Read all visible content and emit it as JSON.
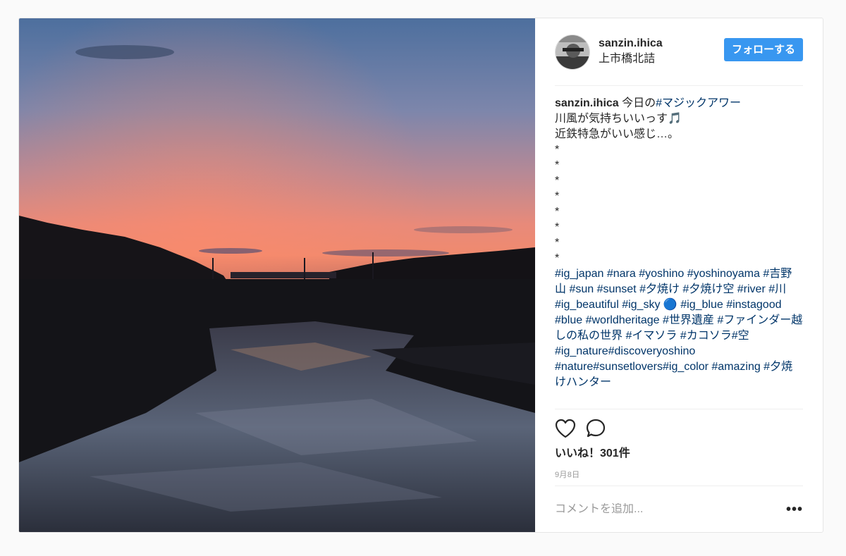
{
  "post": {
    "username": "sanzin.ihica",
    "location": "上市橋北詰",
    "follow_label": "フォローする"
  },
  "caption": {
    "user": "sanzin.ihica",
    "intro": " 今日の",
    "intro_tag": "#マジックアワー",
    "line2": "\n川風が気持ちいいっす🎵\n近鉄特急がいい感じ…。\n*\n*\n*\n*\n*\n*\n*\n*\n",
    "hashtags": "#ig_japan #nara #yoshino #yoshinoyama #吉野山 #sun #sunset #夕焼け #夕焼け空 #river #川 #ig_beautiful #ig_sky 🔵 #ig_blue #instagood #blue #worldheritage #世界遺産 #ファインダー越しの私の世界 #イマソラ #カコソラ#空 #ig_nature#discoveryoshino #nature#sunsetlovers#ig_color #amazing #夕焼けハンター"
  },
  "actions": {
    "like_icon": "heart-icon",
    "comment_icon": "comment-bubble-icon"
  },
  "likes_text": "いいね！301件",
  "date_text": "9月8日",
  "comment": {
    "placeholder": "コメントを追加...",
    "more_icon": "•••"
  },
  "colors": {
    "accent": "#3897f0",
    "hashtag": "#003569"
  }
}
